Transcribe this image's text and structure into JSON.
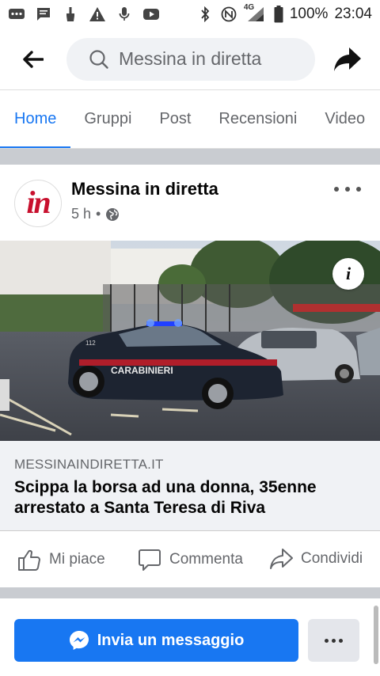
{
  "status_bar": {
    "battery": "100%",
    "time": "23:04",
    "network": "4G",
    "icons": [
      "messages-icon",
      "chat-icon",
      "brush-icon",
      "warning-icon",
      "mic-icon",
      "youtube-icon"
    ]
  },
  "header": {
    "search_placeholder": "Messina in diretta"
  },
  "tabs": [
    {
      "label": "Home",
      "active": true
    },
    {
      "label": "Gruppi"
    },
    {
      "label": "Post"
    },
    {
      "label": "Recensioni"
    },
    {
      "label": "Video"
    }
  ],
  "post": {
    "author": "Messina in diretta",
    "avatar_text": "in",
    "time": "5 h",
    "separator": "•",
    "photo_caption": "CARABINIERI",
    "photo_plate": "112",
    "link": {
      "domain": "MESSINAINDIRETTA.IT",
      "title": "Scippa la borsa ad una donna, 35enne arrestato a Santa Teresa di Riva"
    },
    "actions": {
      "like": "Mi piace",
      "comment": "Commenta",
      "share": "Condividi"
    }
  },
  "footer": {
    "message_button": "Invia un messaggio"
  },
  "colors": {
    "accent": "#1877f2",
    "brand_red": "#c8102e"
  }
}
